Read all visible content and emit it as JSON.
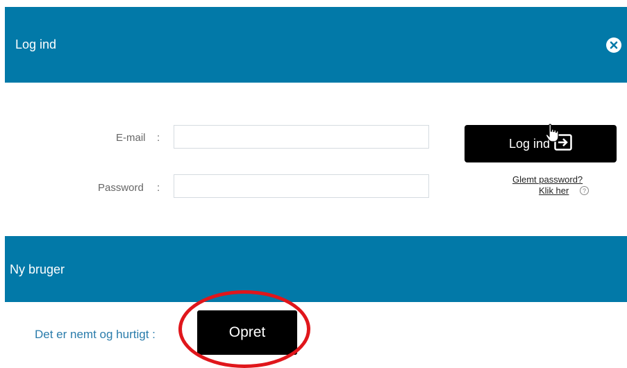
{
  "login_section": {
    "title": "Log ind",
    "close_icon": "close-circle-icon"
  },
  "form": {
    "email_label": "E-mail",
    "email_colon": ":",
    "email_value": "",
    "password_label": "Password",
    "password_colon": ":",
    "password_value": "",
    "login_button_label": "Log ind",
    "login_button_icon": "sign-in-icon",
    "forgot_line1": "Glemt password?",
    "forgot_line2": "Klik her",
    "help_icon": "?"
  },
  "new_user_section": {
    "title": "Ny bruger",
    "promo_text": "Det er nemt og hurtigt :",
    "create_button_label": "Opret"
  },
  "colors": {
    "header_blue": "#0279a8",
    "button_black": "#000000",
    "highlight_red": "#e0161b",
    "promo_text_blue": "#2a7cab"
  }
}
